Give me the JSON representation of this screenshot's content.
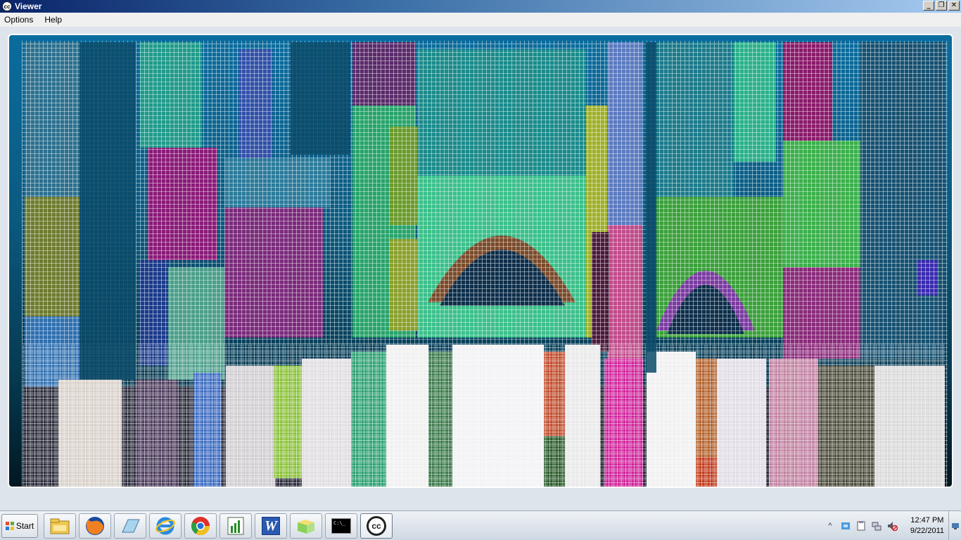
{
  "window": {
    "title": "Viewer",
    "app_icon_label": "cc",
    "minimize_label": "_",
    "maximize_label": "❐",
    "close_label": "✕"
  },
  "menu": {
    "items": [
      "Options",
      "Help"
    ]
  },
  "viewport": {
    "content": "point-cloud-facade",
    "background_top": "#0a6c9e",
    "background_bottom": "#021822"
  },
  "taskbar": {
    "start_label": "Start",
    "apps": [
      {
        "name": "file-explorer-icon"
      },
      {
        "name": "firefox-icon"
      },
      {
        "name": "generic-app-icon"
      },
      {
        "name": "internet-explorer-icon"
      },
      {
        "name": "chrome-icon"
      },
      {
        "name": "chart-app-icon"
      },
      {
        "name": "word-icon",
        "label": "W"
      },
      {
        "name": "folder-app-icon"
      },
      {
        "name": "command-prompt-icon",
        "label": "C:\\_"
      },
      {
        "name": "cloudcompare-icon",
        "label": "cc"
      }
    ],
    "tray": {
      "expand_label": "^",
      "time": "12:47 PM",
      "date": "9/22/2011"
    }
  }
}
